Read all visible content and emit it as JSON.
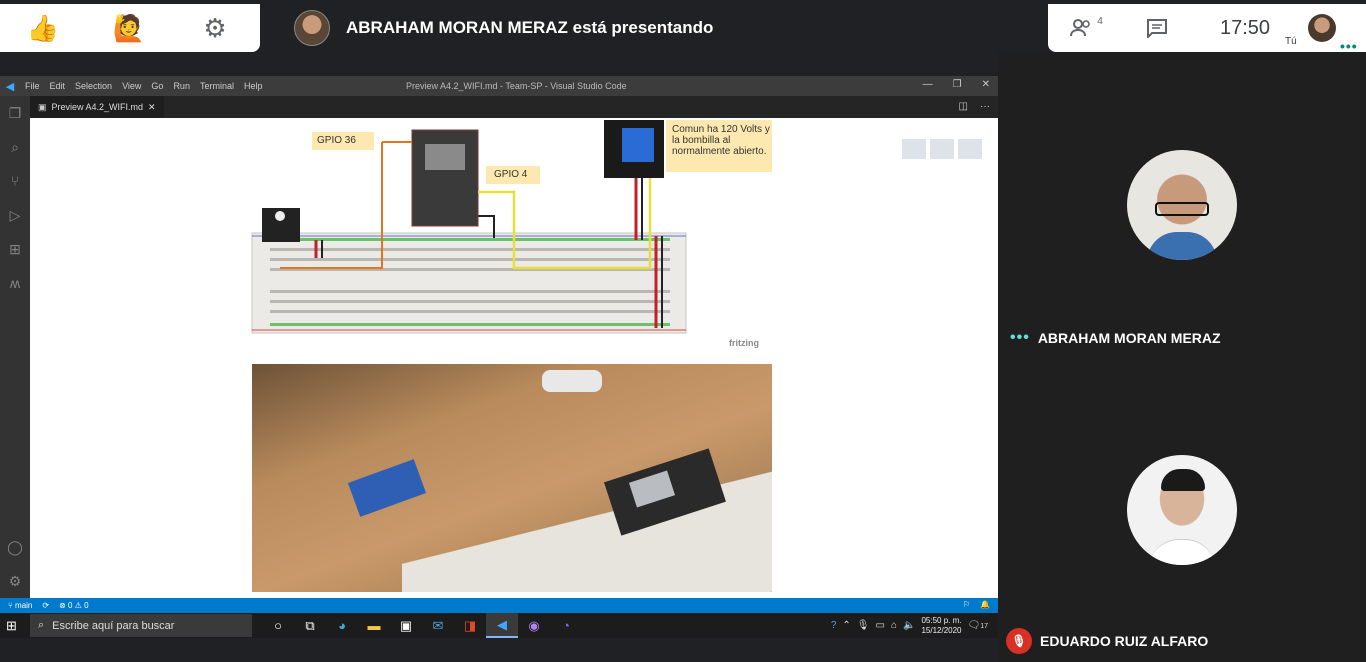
{
  "meet": {
    "presenter_text": "ABRAHAM MORAN MERAZ está presentando",
    "people_count": "4",
    "time": "17:50",
    "you_label": "Tú"
  },
  "vscode": {
    "menu": [
      "File",
      "Edit",
      "Selection",
      "View",
      "Go",
      "Run",
      "Terminal",
      "Help"
    ],
    "window_title": "Preview A4.2_WIFI.md - Team-SP - Visual Studio Code",
    "tab_label": "Preview A4.2_WIFI.md",
    "diagram": {
      "gpio36": "GPIO 36",
      "gpio4": "GPIO 4",
      "relay_note": "Comun ha 120 Volts y la bombilla al normalmente abierto.",
      "watermark": "fritzing"
    },
    "status": {
      "branch": "main",
      "problems": "⊗ 0 ⚠ 0"
    }
  },
  "taskbar": {
    "search_placeholder": "Escribe aquí para buscar",
    "clock_time": "05:50 p. m.",
    "clock_date": "15/12/2020",
    "notif_count": "17"
  },
  "participants": [
    {
      "name": "ABRAHAM MORAN MERAZ",
      "status": "speaking"
    },
    {
      "name": "EDUARDO RUIZ ALFARO",
      "status": "muted"
    }
  ],
  "colors": {
    "accent": "#007acc",
    "meet_bg": "#202124",
    "mute_red": "#d93025"
  }
}
